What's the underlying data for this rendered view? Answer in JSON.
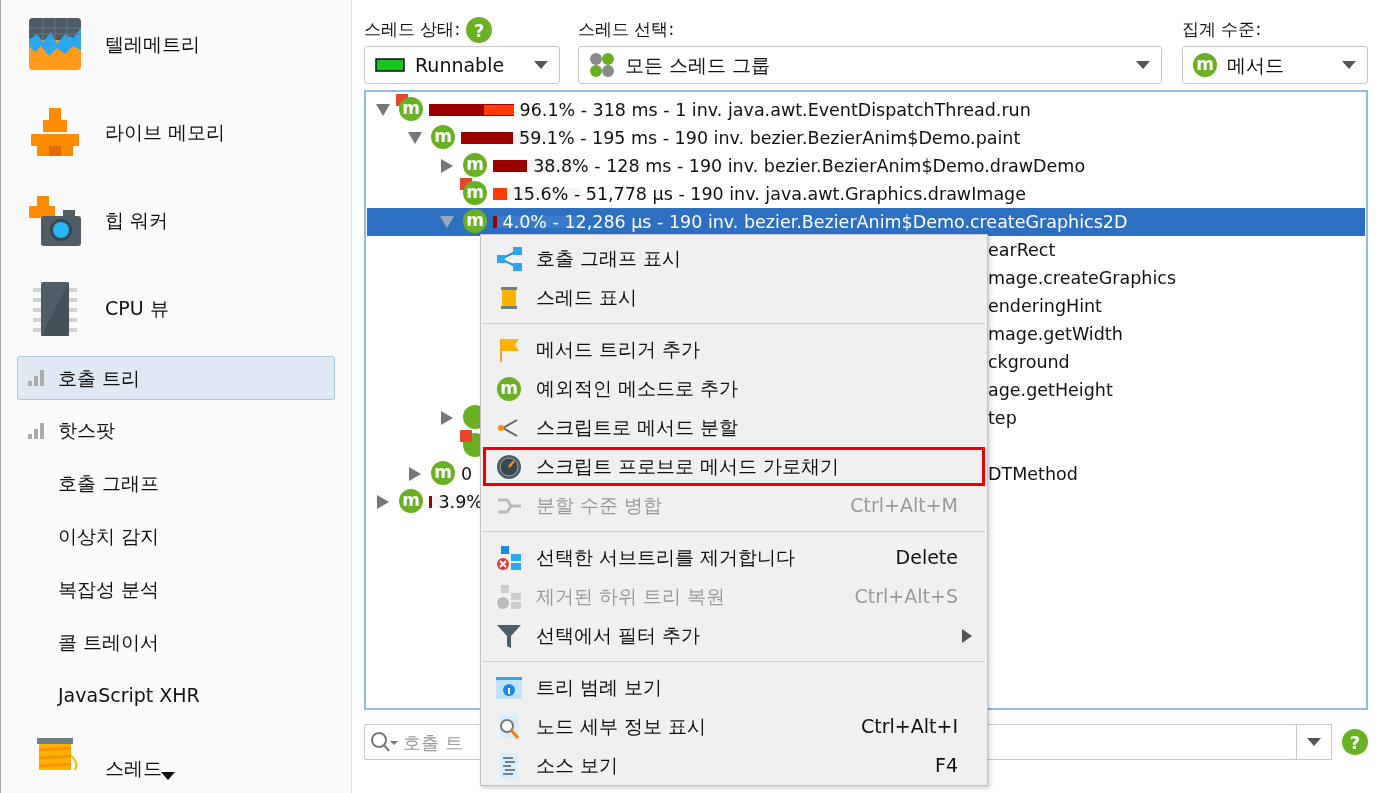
{
  "toolbar": {
    "thread_state": {
      "label": "스레드 상태:",
      "help": "?",
      "value": "Runnable"
    },
    "thread_selection": {
      "label": "스레드 선택:",
      "value": "모든 스레드 그룹"
    },
    "aggregation": {
      "label": "집계 수준:",
      "badge": "m",
      "value": "메서드"
    }
  },
  "sidebar": {
    "items": [
      {
        "kind": "section",
        "label": "텔레메트리",
        "selected": false
      },
      {
        "kind": "section",
        "label": "라이브 메모리",
        "selected": false
      },
      {
        "kind": "section",
        "label": "힙 워커",
        "selected": false
      },
      {
        "kind": "section",
        "label": "CPU 뷰",
        "selected": false
      },
      {
        "kind": "view",
        "label": "호출 트리",
        "selected": true,
        "indicator": true
      },
      {
        "kind": "view",
        "label": "핫스팟",
        "selected": false,
        "indicator": true
      },
      {
        "kind": "view",
        "label": "호출 그래프",
        "selected": false
      },
      {
        "kind": "view",
        "label": "이상치 감지",
        "selected": false
      },
      {
        "kind": "view",
        "label": "복잡성 분석",
        "selected": false
      },
      {
        "kind": "view",
        "label": "콜 트레이서",
        "selected": false
      },
      {
        "kind": "view",
        "label": "JavaScript XHR",
        "selected": false
      },
      {
        "kind": "section",
        "label": "스레드",
        "selected": false
      }
    ]
  },
  "tree": {
    "rows": [
      {
        "expanded": true,
        "hot": true,
        "badge": "m",
        "selected": false,
        "bar": {
          "level": 0.961,
          "self": {
            "level": 0.35
          }
        },
        "text": "96.1% - 318 ms - 1 inv. java.awt.EventDispatchThread.run",
        "children": [
          {
            "expanded": true,
            "badge": "m",
            "selected": false,
            "bar": {
              "level": 0.591
            },
            "text": "59.1% - 195 ms - 190 inv. bezier.BezierAnim$Demo.paint",
            "children": [
              {
                "expanded": false,
                "badge": "m",
                "selected": false,
                "bar": {
                  "level": 0.388
                },
                "text": "38.8% - 128 ms - 190 inv. bezier.BezierAnim$Demo.drawDemo"
              },
              {
                "hot": true,
                "badge": "m",
                "selected": false,
                "bar": {
                  "level": 0.156,
                  "kind": "self"
                },
                "text": "15.6% - 51,778 µs - 190 inv. java.awt.Graphics.drawImage"
              },
              {
                "expanded": true,
                "badge": "m",
                "selected": true,
                "bar": {
                  "level": 0.04
                },
                "text": "4.0% - 12,286 µs - 190 inv. bezier.BezierAnim$Demo.createGraphics2D",
                "children": [
                  {
                    "tail": "earRect"
                  },
                  {
                    "tail": "mage.createGraphics"
                  },
                  {
                    "tail": "enderingHint"
                  },
                  {
                    "tail": "mage.getWidth"
                  },
                  {
                    "tail": "ckground"
                  },
                  {
                    "tail": "age.getHeight"
                  }
                ]
              },
              {
                "expanded": false,
                "covered_icon": true,
                "selected": false,
                "tail": "tep"
              },
              {
                "hot": true,
                "covered_icon": true,
                "selected": false
              }
            ]
          },
          {
            "expanded": false,
            "badge": "m",
            "selected": false,
            "text": "0",
            "tail": "DTMethod"
          }
        ]
      },
      {
        "expanded": false,
        "badge": "m",
        "selected": false,
        "bar": {
          "level": 0.039
        },
        "text": "3.9%"
      }
    ]
  },
  "search": {
    "placeholder": "호출 트",
    "help": "?"
  },
  "context_menu": {
    "groups": [
      [
        {
          "label": "호출 그래프 표시",
          "disabled": false,
          "outlined": false
        },
        {
          "label": "스레드 표시",
          "disabled": false,
          "outlined": false
        }
      ],
      [
        {
          "label": "메서드 트리거 추가",
          "disabled": false,
          "outlined": false
        },
        {
          "label": "예외적인 메소드로 추가",
          "badge": "m",
          "disabled": false,
          "outlined": false
        },
        {
          "label": "스크립트로 메서드 분할",
          "disabled": false,
          "outlined": false
        },
        {
          "label": "스크립트 프로브로 메서드 가로채기",
          "disabled": false,
          "outlined": true
        },
        {
          "label": "분할 수준 병합",
          "shortcut": "Ctrl+Alt+M",
          "disabled": true,
          "outlined": false
        }
      ],
      [
        {
          "label": "선택한 서브트리를 제거합니다",
          "shortcut": "Delete",
          "disabled": false,
          "outlined": false
        },
        {
          "label": "제거된 하위 트리 복원",
          "shortcut": "Ctrl+Alt+S",
          "disabled": true,
          "outlined": false
        },
        {
          "label": "선택에서 필터 추가",
          "submenu": true,
          "disabled": false,
          "outlined": false
        }
      ],
      [
        {
          "label": "트리 범례 보기",
          "disabled": false,
          "outlined": false
        },
        {
          "label": "노드 세부 정보 표시",
          "shortcut": "Ctrl+Alt+I",
          "disabled": false,
          "outlined": false
        },
        {
          "label": "소스 보기",
          "shortcut": "F4",
          "disabled": false,
          "outlined": false
        }
      ]
    ]
  }
}
